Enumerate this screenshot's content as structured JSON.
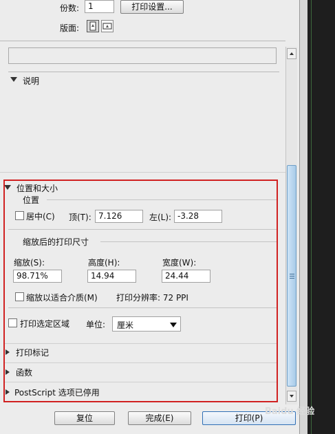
{
  "top": {
    "copies_label": "份数:",
    "copies_value": "1",
    "print_settings_button": "打印设置...",
    "layout_label": "版面:"
  },
  "sections": {
    "description": "说明",
    "position_size": "位置和大小",
    "print_marks": "打印标记",
    "functions": "函数",
    "postscript": "PostScript 选项已停用"
  },
  "position": {
    "group_title": "位置",
    "center_label": "居中(C)",
    "top_label": "顶(T):",
    "top_value": "7.126",
    "left_label": "左(L):",
    "left_value": "-3.28"
  },
  "scaled": {
    "group_title": "缩放后的打印尺寸",
    "scale_label": "缩放(S):",
    "scale_value": "98.71%",
    "height_label": "高度(H):",
    "height_value": "14.94",
    "width_label": "宽度(W):",
    "width_value": "24.44",
    "fit_media_label": "缩放以适合介质(M)",
    "resolution_text": "打印分辨率: 72 PPI"
  },
  "print_selected_label": "打印选定区域",
  "unit": {
    "label": "单位:",
    "value": "厘米"
  },
  "footer": {
    "reset_button": "复位",
    "done_button": "完成(E)",
    "print_button": "打印(P)"
  },
  "watermark_text": "Baidu 经验"
}
